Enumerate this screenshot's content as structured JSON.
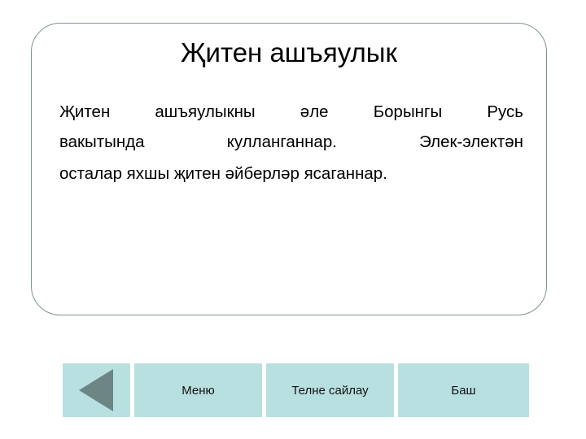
{
  "slide": {
    "title": "Җитен ашъяулык",
    "body": {
      "line1_words": [
        "Җитен",
        "ашъяулыкны",
        "әле",
        "Борынгы",
        "Русь"
      ],
      "line2_words": [
        "вакытында",
        "кулланганнар.",
        "Элек-электән"
      ],
      "line3": "осталар яхшы җитен әйберләр ясаганнар."
    }
  },
  "nav": {
    "back": {
      "label": "",
      "icon": "back-arrow-icon"
    },
    "menu": {
      "label": "Меню"
    },
    "language": {
      "label": "Телне сайлау"
    },
    "home": {
      "label": "Баш"
    }
  },
  "colors": {
    "card_border": "#7e9493",
    "button_fill": "#b9e0e0",
    "arrow_fill": "#6d8585",
    "text": "#000000",
    "background": "#ffffff"
  }
}
